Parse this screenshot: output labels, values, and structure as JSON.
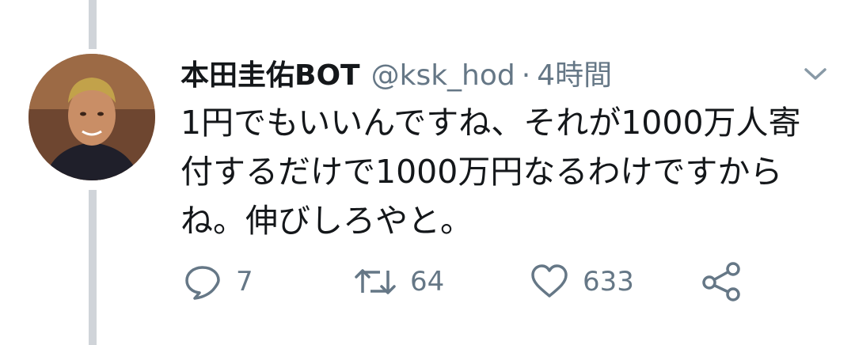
{
  "tweet": {
    "display_name": "本田圭佑BOT",
    "handle": "@ksk_hod",
    "separator": "·",
    "time": "4時間",
    "text_lines": [
      "1円でもいいんですね、それが1000万人寄",
      "付するだけで1000万円なるわけですから",
      "ね。伸びしろやと。"
    ]
  },
  "actions": {
    "reply_count": "7",
    "retweet_count": "64",
    "like_count": "633"
  },
  "icons": {
    "reply": "reply-icon",
    "retweet": "retweet-icon",
    "like": "heart-icon",
    "share": "share-icon",
    "menu": "chevron-down-icon"
  },
  "colors": {
    "text": "#14171a",
    "secondary": "#657786",
    "thread_line": "#d0d4d9"
  }
}
